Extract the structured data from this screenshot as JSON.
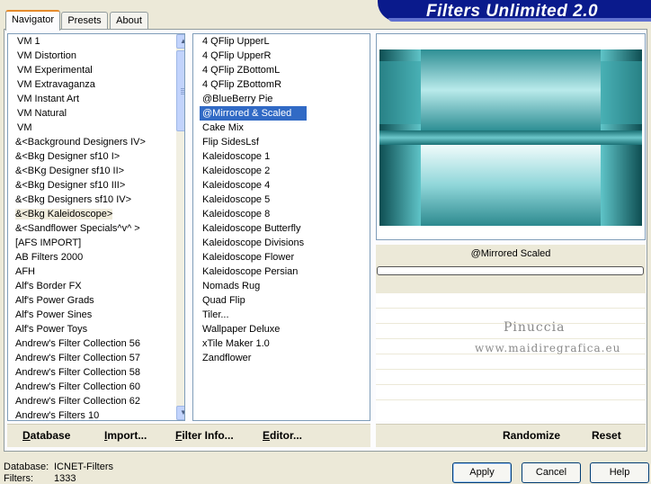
{
  "header": {
    "title": "Filters Unlimited 2.0"
  },
  "tabs": [
    {
      "label": "Navigator",
      "active": true
    },
    {
      "label": "Presets",
      "active": false
    },
    {
      "label": "About",
      "active": false
    }
  ],
  "categories": [
    "VM 1",
    "VM Distortion",
    "VM Experimental",
    "VM Extravaganza",
    "VM Instant Art",
    "VM Natural",
    "VM",
    "&<Background Designers IV>",
    "&<Bkg Designer sf10 I>",
    "&<BKg Designer sf10 II>",
    "&<Bkg Designer sf10 III>",
    "&<Bkg Designers sf10 IV>",
    "&<Bkg Kaleidoscope>",
    "&<Sandflower Specials^v^ >",
    "[AFS IMPORT]",
    "AB Filters 2000",
    "AFH",
    "Alf's Border FX",
    "Alf's Power Grads",
    "Alf's Power Sines",
    "Alf's Power Toys",
    "Andrew's Filter Collection 56",
    "Andrew's Filter Collection 57",
    "Andrew's Filter Collection 58",
    "Andrew's Filter Collection 60",
    "Andrew's Filter Collection 62",
    "Andrew's Filters 10"
  ],
  "selected_category": "&<Bkg Kaleidoscope>",
  "filters": [
    "4 QFlip UpperL",
    "4 QFlip UpperR",
    "4 QFlip ZBottomL",
    "4 QFlip ZBottomR",
    "@BlueBerry Pie",
    "@Mirrored & Scaled",
    "Cake Mix",
    "Flip SidesLsf",
    "Kaleidoscope 1",
    "Kaleidoscope 2",
    "Kaleidoscope 4",
    "Kaleidoscope 5",
    "Kaleidoscope 8",
    "Kaleidoscope Butterfly",
    "Kaleidoscope Divisions",
    "Kaleidoscope Flower",
    "Kaleidoscope Persian",
    "Nomads Rug",
    "Quad Flip",
    "Tiler...",
    "Wallpaper Deluxe",
    "xTile Maker 1.0",
    "Zandflower"
  ],
  "selected_filter": "@Mirrored & Scaled",
  "preview": {
    "filter_name": "@Mirrored  Scaled",
    "progress": 0,
    "colors": {
      "teal_light": "#b9eaeb",
      "teal_mid": "#5fc4c8",
      "teal_dark": "#0e4e52"
    },
    "watermark_line1": "Pinuccia",
    "watermark_line2": "www.maidiregrafica.eu"
  },
  "link_bar": {
    "database": "Database",
    "import": "Import...",
    "filter_info": "Filter Info...",
    "editor": "Editor...",
    "randomize": "Randomize",
    "reset": "Reset"
  },
  "footer": {
    "database_key": "Database:",
    "database_value": "ICNET-Filters",
    "filters_key": "Filters:",
    "filters_value": "1333",
    "apply": "Apply",
    "cancel": "Cancel",
    "help": "Help"
  }
}
